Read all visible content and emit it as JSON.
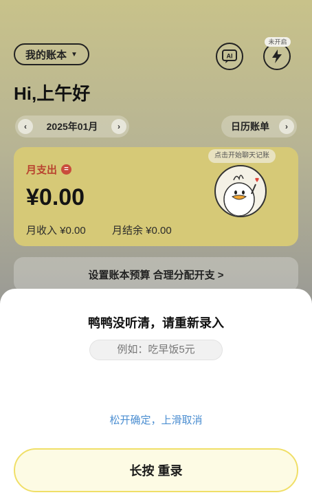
{
  "header": {
    "ledger_label": "我的账本",
    "ai_icon_text": "AI",
    "bolt_badge": "未开启"
  },
  "greeting": "Hi,上午好",
  "month_selector": {
    "month": "2025年01月",
    "prev": "‹",
    "next": "›"
  },
  "calendar": {
    "label": "日历账单",
    "arrow": "›"
  },
  "summary_card": {
    "expense_label": "月支出",
    "expense_amount": "¥0.00",
    "income_label": "月收入 ¥0.00",
    "balance_label": "月结余 ¥0.00",
    "bubble_text": "点击开始聊天记账"
  },
  "budget_banner": "设置账本预算 合理分配开支 >",
  "sheet": {
    "title": "鸭鸭没听清，请重新录入",
    "example": "例如：吃早饭5元",
    "hint": "松开确定，上滑取消",
    "record_button": "长按 重录"
  },
  "colors": {
    "accent_yellow": "#f0df67",
    "hint_blue": "#4b8ed1",
    "expense_red": "#c94c3c"
  }
}
